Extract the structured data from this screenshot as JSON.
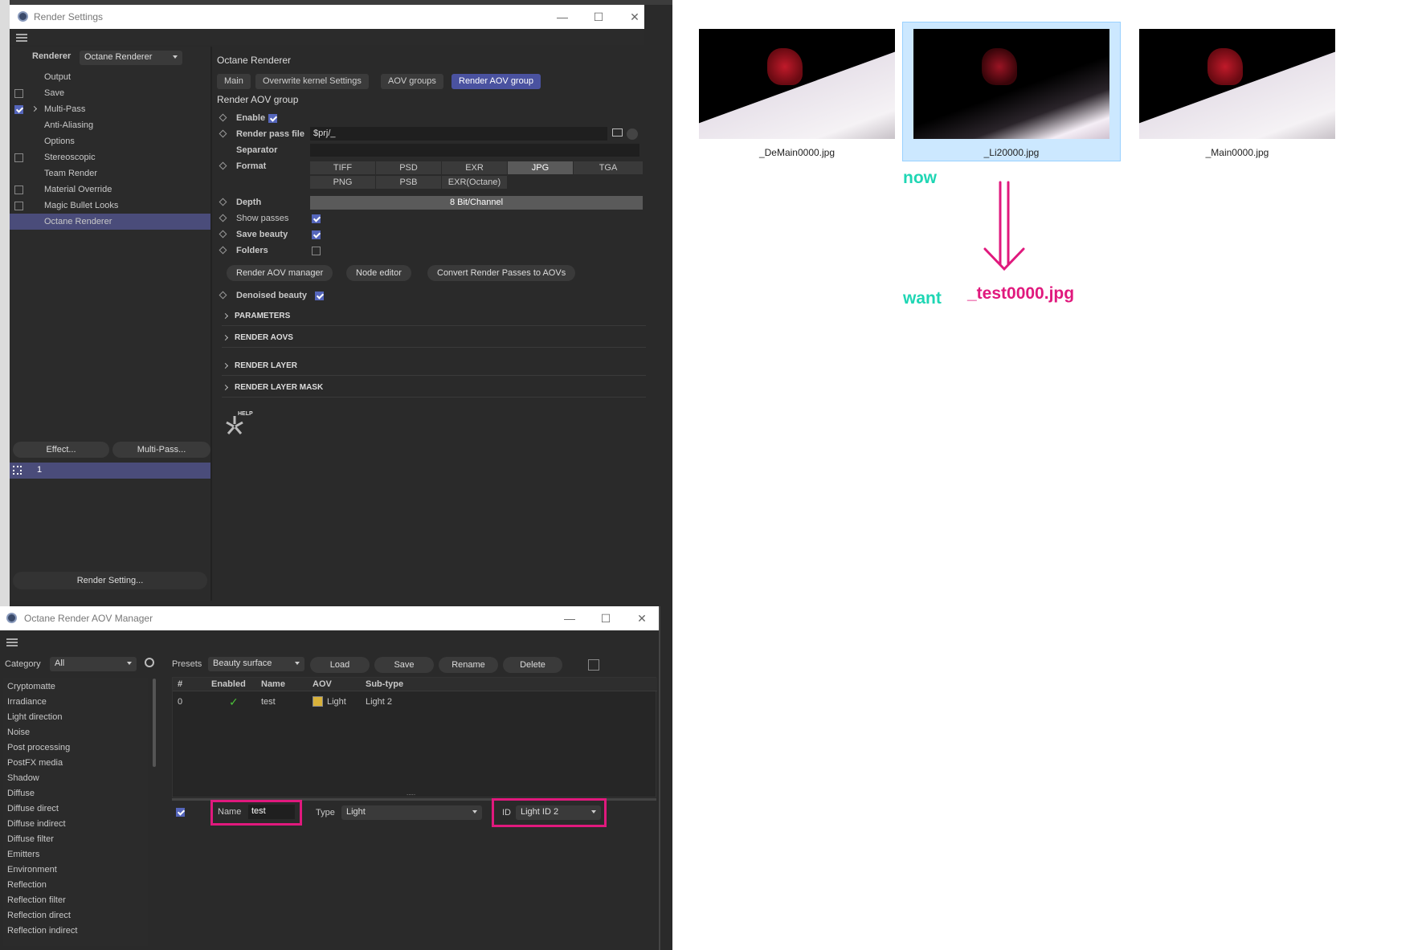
{
  "render_settings": {
    "title": "Render Settings",
    "renderer_label": "Renderer",
    "renderer_value": "Octane Renderer",
    "left_items": [
      {
        "label": "Output",
        "checkbox": false,
        "checked": false
      },
      {
        "label": "Save",
        "checkbox": true,
        "checked": false
      },
      {
        "label": "Multi-Pass",
        "checkbox": true,
        "checked": true,
        "expander": true
      },
      {
        "label": "Anti-Aliasing",
        "checkbox": false,
        "checked": false
      },
      {
        "label": "Options",
        "checkbox": false,
        "checked": false
      },
      {
        "label": "Stereoscopic",
        "checkbox": true,
        "checked": false
      },
      {
        "label": "Team Render",
        "checkbox": false,
        "checked": false
      },
      {
        "label": "Material Override",
        "checkbox": true,
        "checked": false
      },
      {
        "label": "Magic Bullet Looks",
        "checkbox": true,
        "checked": false
      },
      {
        "label": "Octane Renderer",
        "checkbox": false,
        "checked": false,
        "selected": true
      }
    ],
    "effect_button": "Effect...",
    "multipass_button": "Multi-Pass...",
    "preset_row_label": "1",
    "render_setting_button": "Render Setting...",
    "panel_title": "Octane Renderer",
    "tabs": [
      "Main",
      "Overwrite kernel Settings",
      "AOV groups",
      "Render AOV group"
    ],
    "group_title": "Render AOV group",
    "enable_label": "Enable",
    "render_pass_file_label": "Render pass file",
    "render_pass_file_value": "$prj/_",
    "separator_label": "Separator",
    "format_label": "Format",
    "formats_row1": [
      "TIFF",
      "PSD",
      "EXR",
      "JPG",
      "TGA"
    ],
    "formats_row2": [
      "PNG",
      "PSB",
      "EXR(Octane)"
    ],
    "depth_label": "Depth",
    "depth_value": "8 Bit/Channel",
    "show_passes_label": "Show passes",
    "save_beauty_label": "Save beauty",
    "folders_label": "Folders",
    "buttons": [
      "Render AOV manager",
      "Node editor",
      "Convert Render Passes to AOVs"
    ],
    "denoised_beauty_label": "Denoised beauty",
    "sections": [
      "PARAMETERS",
      "RENDER AOVS",
      "RENDER LAYER",
      "RENDER LAYER MASK"
    ],
    "help_label": "HELP"
  },
  "aov_manager": {
    "title": "Octane Render AOV Manager",
    "category_label": "Category",
    "category_value": "All",
    "presets_label": "Presets",
    "presets_value": "Beauty surface",
    "load": "Load",
    "save": "Save",
    "rename": "Rename",
    "delete": "Delete",
    "categories": [
      "Cryptomatte",
      "Irradiance",
      "Light direction",
      "Noise",
      "Post processing",
      "PostFX media",
      "Shadow",
      "Diffuse",
      "Diffuse direct",
      "Diffuse indirect",
      "Diffuse filter",
      "Emitters",
      "Environment",
      "Reflection",
      "Reflection filter",
      "Reflection direct",
      "Reflection indirect"
    ],
    "columns": [
      "#",
      "Enabled",
      "Name",
      "AOV",
      "Sub-type"
    ],
    "rows": [
      {
        "num": "0",
        "enabled": "✓",
        "name": "test",
        "aov": "Light",
        "subtype": "Light 2"
      }
    ],
    "divider_dots": ".....",
    "name_label": "Name",
    "name_value": "test",
    "type_label": "Type",
    "type_value": "Light",
    "id_label": "ID",
    "id_value": "Light ID 2"
  },
  "files": [
    {
      "name": "_DeMain0000.jpg"
    },
    {
      "name": "_Li20000.jpg",
      "selected": true
    },
    {
      "name": "_Main0000.jpg"
    }
  ],
  "annotations": {
    "now": "now",
    "want": "want",
    "wanted_file": "_test0000.jpg",
    "accent_teal": "#1fd6b4",
    "accent_pink": "#e0197d"
  }
}
